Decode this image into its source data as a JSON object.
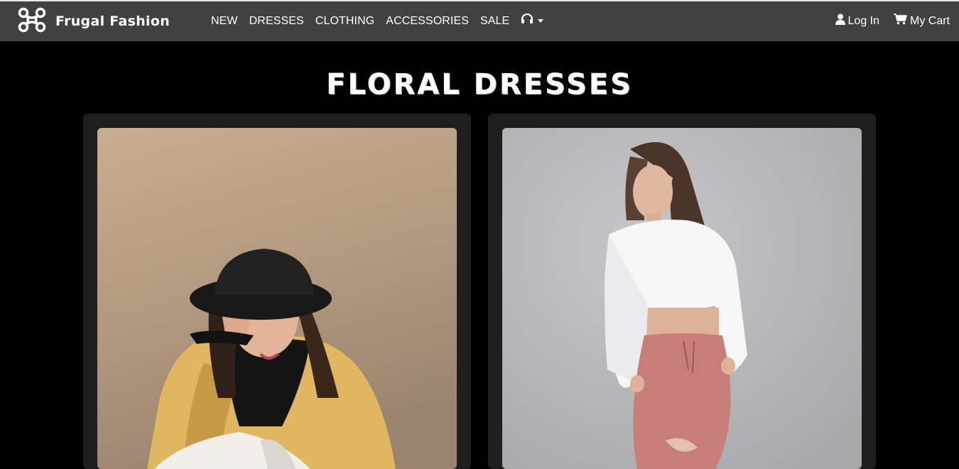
{
  "brand": {
    "name": "Frugal Fashion",
    "logo_icon": "drone-icon"
  },
  "nav": {
    "items": [
      {
        "label": "NEW"
      },
      {
        "label": "DRESSES"
      },
      {
        "label": "CLOTHING"
      },
      {
        "label": "ACCESSORIES"
      },
      {
        "label": "SALE"
      }
    ],
    "support_icon": "headset-icon"
  },
  "account": {
    "login_label": "Log In",
    "login_icon": "user-icon",
    "cart_label": "My Cart",
    "cart_icon": "cart-icon"
  },
  "page": {
    "title": "FLORAL DRESSES"
  },
  "products": [
    {
      "photo": "woman in black bucket hat and yellow jacket"
    },
    {
      "photo": "woman in white cropped sweatshirt and pink ripped joggers"
    }
  ],
  "colors": {
    "navbar": "#414141",
    "background": "#000000",
    "card": "#1e1e1e"
  }
}
